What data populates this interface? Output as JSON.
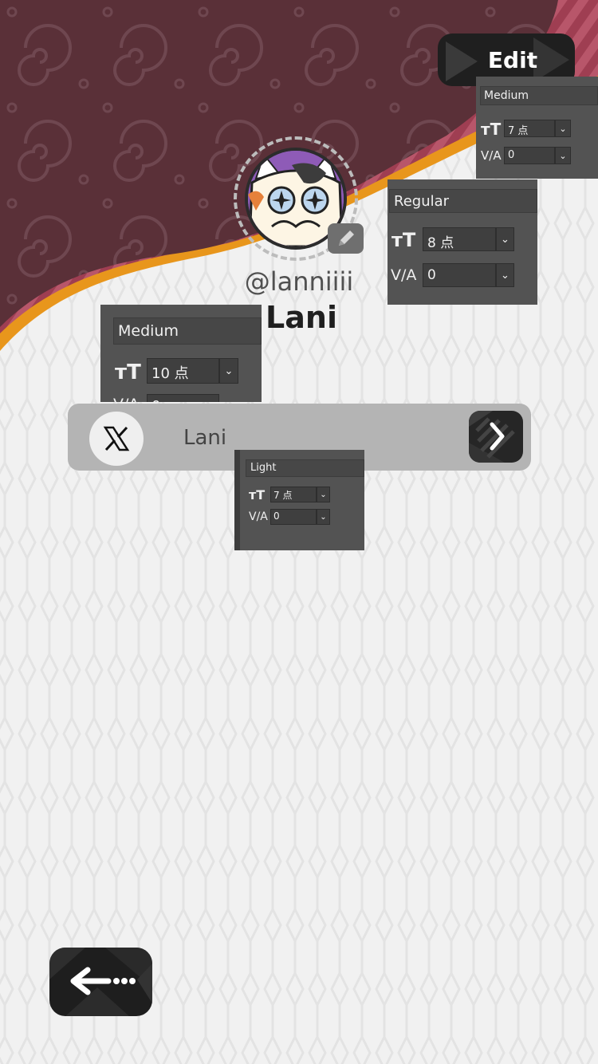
{
  "header": {
    "edit_label": "Edit"
  },
  "profile": {
    "handle": "@lanniiii",
    "name": "Lani",
    "avatar_icon": "cat-avatar-icon",
    "edit_avatar_icon": "pencil-icon"
  },
  "panels": [
    {
      "weight": "Medium",
      "size": "7 点",
      "tracking": "0"
    },
    {
      "weight": "Regular",
      "size": "8 点",
      "tracking": "0"
    },
    {
      "weight": "Medium",
      "size": "10 点",
      "tracking": "0"
    },
    {
      "weight": "Light",
      "size": "7 点",
      "tracking": "0"
    }
  ],
  "link": {
    "platform_icon": "x-logo-icon",
    "label": "Lani",
    "go_icon": "chevron-right-icon"
  },
  "nav": {
    "back_icon": "arrow-left-icon"
  },
  "colors": {
    "header_maroon": "#5a2f36",
    "stripe_band": "#b44a5e",
    "accent_orange": "#e8961c",
    "background": "#f1f1f1",
    "button_dark": "#1f1f1f"
  }
}
